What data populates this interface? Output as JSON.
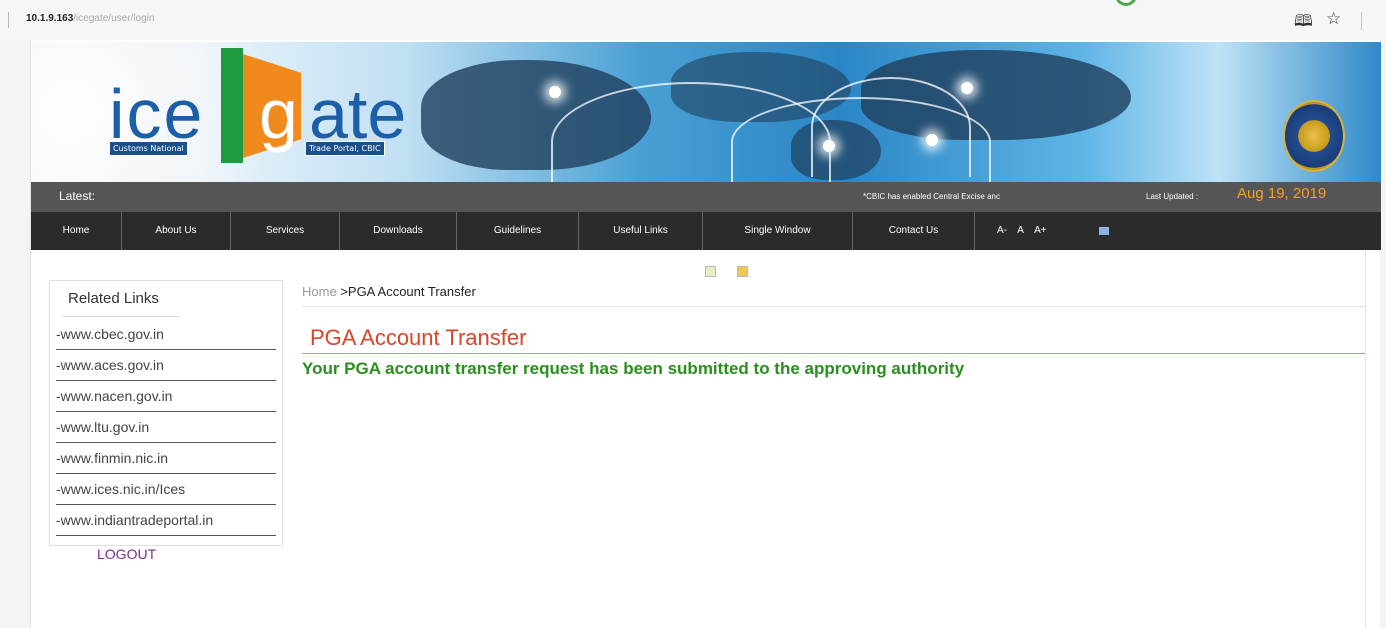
{
  "browser": {
    "url_host": "10.1.9.163",
    "url_path": "/icegate/user/login",
    "reader_icon": "book-open-icon",
    "star_icon": "star-icon"
  },
  "banner": {
    "logo_ice": "ice",
    "logo_g": "g",
    "logo_ate": "ate",
    "tag_left": "Customs National",
    "tag_right": "Trade Portal, CBIC"
  },
  "latest": {
    "label": "Latest:",
    "ticker": "*CBIC has enabled Central Excise anc",
    "updated_label": "Last Updated :",
    "updated_date": "Aug 19, 2019"
  },
  "nav": {
    "items": [
      {
        "label": "Home"
      },
      {
        "label": "About Us"
      },
      {
        "label": "Services"
      },
      {
        "label": "Downloads"
      },
      {
        "label": "Guidelines"
      },
      {
        "label": "Useful Links"
      },
      {
        "label": "Single Window"
      },
      {
        "label": "Contact Us"
      }
    ],
    "font_minus": "A-",
    "font_normal": "A",
    "font_plus": "A+"
  },
  "sidebar": {
    "heading": "Related Links",
    "links": [
      {
        "label": "-www.cbec.gov.in"
      },
      {
        "label": "-www.aces.gov.in"
      },
      {
        "label": "-www.nacen.gov.in"
      },
      {
        "label": "-www.ltu.gov.in"
      },
      {
        "label": "-www.finmin.nic.in"
      },
      {
        "label": "-www.ices.nic.in/Ices"
      },
      {
        "label": "-www.indiantradeportal.in"
      }
    ],
    "logout": "LOGOUT"
  },
  "main": {
    "breadcrumb_home": "Home",
    "breadcrumb_current": ">PGA Account Transfer",
    "title": "PGA Account Transfer",
    "message": "Your PGA account transfer request has been submitted to the approving authority"
  },
  "colors": {
    "title": "#d9452b",
    "message": "#2a8f1f",
    "updated_date": "#f3a21e",
    "nav_bg": "#2b2b2b",
    "latest_bg": "#555555",
    "logout": "#7b2c8f"
  }
}
